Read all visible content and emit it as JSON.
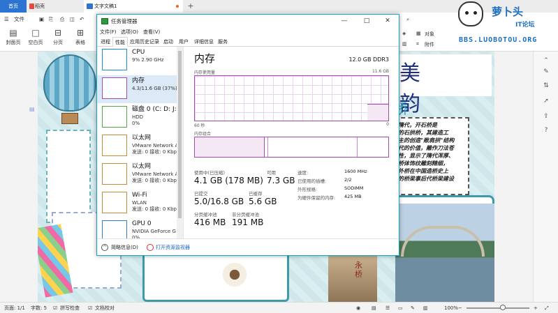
{
  "wps": {
    "tabs": {
      "home": "首页",
      "daoke": "稻壳",
      "doc": "文字文稿1",
      "add": "+"
    },
    "menu": {
      "file": "文件"
    },
    "ribbon": {
      "cover": "封面页",
      "blank": "空白页",
      "section": "分页",
      "table": "表格",
      "object": "对象",
      "attachment": "附件"
    },
    "status": {
      "page": "页面: 1/1",
      "words": "字数: 5",
      "spell": "拼写检查",
      "proof": "文档校对",
      "zoom": "100%"
    }
  },
  "doc": {
    "title": "美 韵",
    "qiao": "桥",
    "text_lines": [
      "隋代，开石桥是",
      "的石拱桥，其建造工",
      "主的创造\"敞肩拱\"结构",
      "代的价值，雕作刀法苍",
      "性，显示了隋代浑厚、",
      "桥体饰纹雕刻精细，",
      "外桥在中国造桥史上",
      "的桥梁事后代桥梁建设"
    ],
    "stone": "永桥"
  },
  "taskmgr": {
    "title": "任务管理器",
    "menu": [
      "文件(F)",
      "选项(O)",
      "查看(V)"
    ],
    "tabs": [
      "进程",
      "性能",
      "应用历史记录",
      "启动",
      "用户",
      "详细信息",
      "服务"
    ],
    "active_tab": "性能",
    "resources": [
      {
        "name": "CPU",
        "sub1": "9% 2.90 GHz",
        "sub2": "",
        "color": "#1a8fd6",
        "selected": false
      },
      {
        "name": "内存",
        "sub1": "4.3/11.6 GB (37%)",
        "sub2": "",
        "color": "#a64ab0",
        "selected": true
      },
      {
        "name": "磁盘 0 (C: D: J:",
        "sub1": "HDD",
        "sub2": "0%",
        "color": "#4cab3c",
        "selected": false
      },
      {
        "name": "以太网",
        "sub1": "VMware Network A",
        "sub2": "发送: 0 接收: 0 Kbp",
        "color": "#c98a3a",
        "selected": false
      },
      {
        "name": "以太网",
        "sub1": "VMware Network A",
        "sub2": "发送: 0 接收: 0 Kbp",
        "color": "#c98a3a",
        "selected": false
      },
      {
        "name": "Wi-Fi",
        "sub1": "WLAN",
        "sub2": "发送: 0 接收: 0 Kbp",
        "color": "#c98a3a",
        "selected": false
      },
      {
        "name": "GPU 0",
        "sub1": "NVIDIA GeForce G",
        "sub2": "0%",
        "color": "#2b7bd1",
        "selected": false
      }
    ],
    "memory": {
      "title": "内存",
      "spec": "12.0 GB DDR3",
      "usage_label": "内存使用量",
      "usage_max": "11.6 GB",
      "axis_left": "60 秒",
      "axis_right": "0",
      "composition_label": "内存组合",
      "in_use_label": "使用中(已压缩)",
      "in_use_value": "4.1 GB (178 MB)",
      "available_label": "可用",
      "available_value": "7.3 GB",
      "committed_label": "已提交",
      "committed_value": "5.0/16.8 GB",
      "cached_label": "已缓存",
      "cached_value": "5.6 GB",
      "paged_label": "分页缓冲池",
      "paged_value": "416 MB",
      "nonpaged_label": "非分页缓冲池",
      "nonpaged_value": "191 MB",
      "speed_label": "速度:",
      "speed_value": "1600 MHz",
      "slots_label": "已使用的插槽:",
      "slots_value": "2/2",
      "form_label": "外形规格:",
      "form_value": "SODIMM",
      "reserved_label": "为硬件保留的内存:",
      "reserved_value": "425 MB",
      "usage_fraction": 0.37
    },
    "footer": {
      "brief": "简略信息(D)",
      "open_monitor": "打开资源监视器"
    }
  },
  "watermark": {
    "line1": "萝卜头",
    "line2": "IT论坛",
    "url": "BBS.LUOBOTOU.ORG"
  }
}
